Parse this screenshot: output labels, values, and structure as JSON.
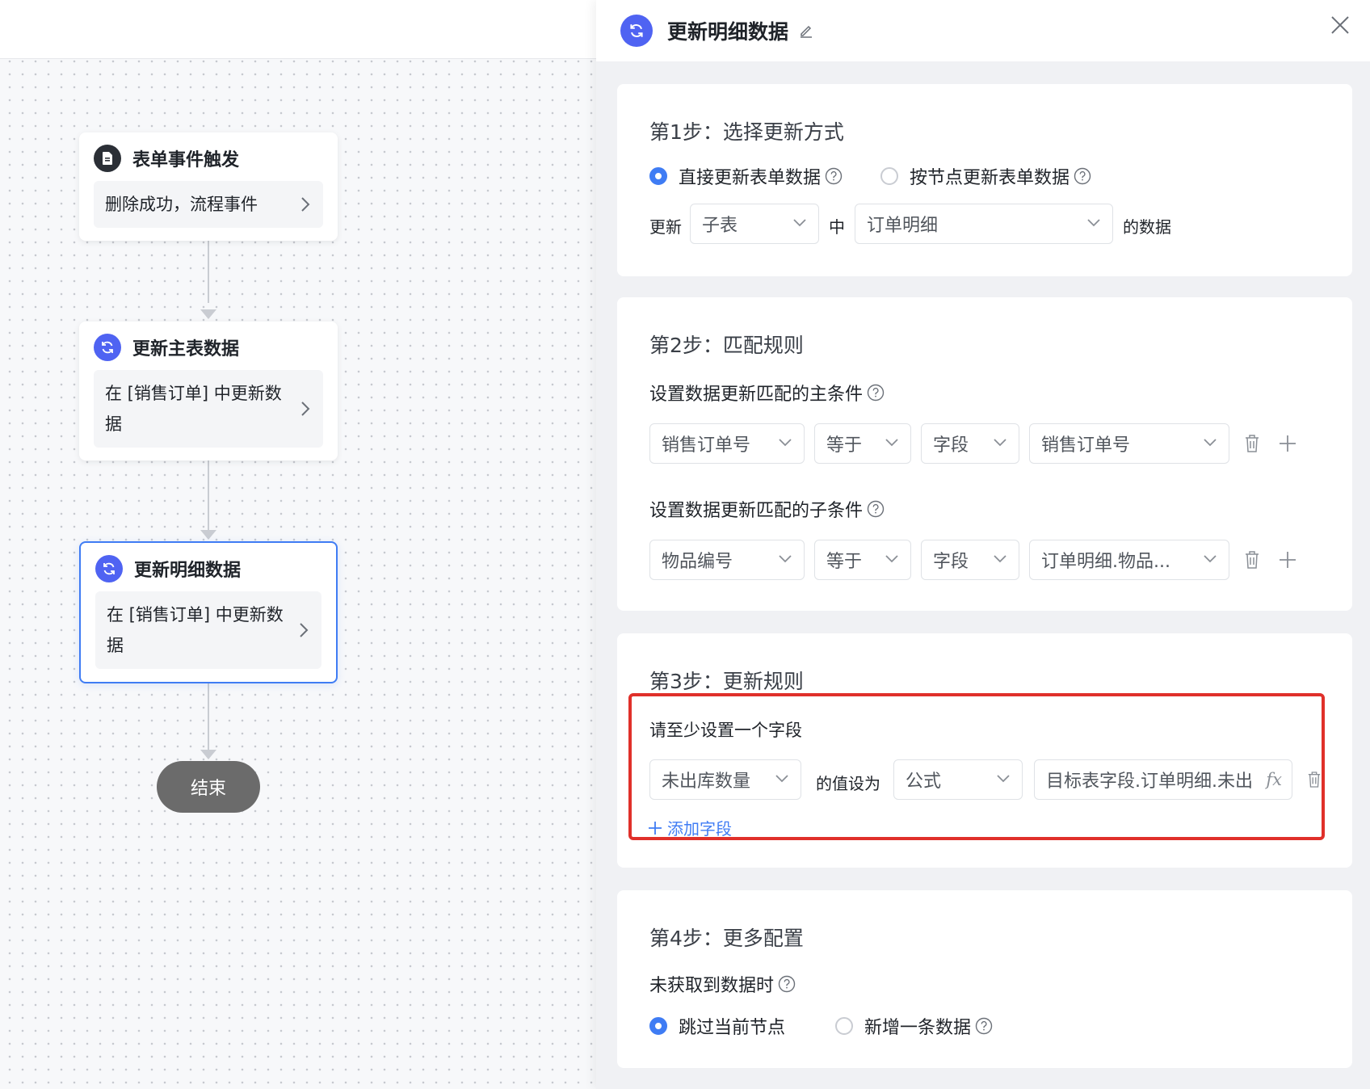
{
  "flow": {
    "nodes": [
      {
        "title": "表单事件触发",
        "body": "删除成功，流程事件"
      },
      {
        "title": "更新主表数据",
        "body": "在 [销售订单] 中更新数据"
      },
      {
        "title": "更新明细数据",
        "body": "在 [销售订单] 中更新数据"
      }
    ],
    "end_label": "结束"
  },
  "panel": {
    "title": "更新明细数据",
    "step1": {
      "title": "第1步：选择更新方式",
      "radio_direct": "直接更新表单数据",
      "radio_by_node": "按节点更新表单数据",
      "update_label": "更新",
      "table_type": "子表",
      "in_label": "中",
      "subtable": "订单明细",
      "data_suffix": "的数据"
    },
    "step2": {
      "title": "第2步：匹配规则",
      "main_label": "设置数据更新匹配的主条件",
      "main_condition": {
        "field": "销售订单号",
        "operator": "等于",
        "value_type": "字段",
        "value": "销售订单号"
      },
      "sub_label": "设置数据更新匹配的子条件",
      "sub_condition": {
        "field": "物品编号",
        "operator": "等于",
        "value_type": "字段",
        "value": "订单明细.物品..."
      }
    },
    "step3": {
      "title": "第3步：更新规则",
      "hint": "请至少设置一个字段",
      "field": "未出库数量",
      "set_label": "的值设为",
      "value_type": "公式",
      "formula": "目标表字段.订单明细.未出...",
      "fx_label": "fx",
      "add_field": "添加字段"
    },
    "step4": {
      "title": "第4步：更多配置",
      "no_data_label": "未获取到数据时",
      "radio_skip": "跳过当前节点",
      "radio_add": "新增一条数据"
    }
  },
  "colors": {
    "accent": "#3f7cf4",
    "node_icon": "#4f63f2",
    "highlight": "#e0302a",
    "end_node": "#6b6b6b"
  }
}
